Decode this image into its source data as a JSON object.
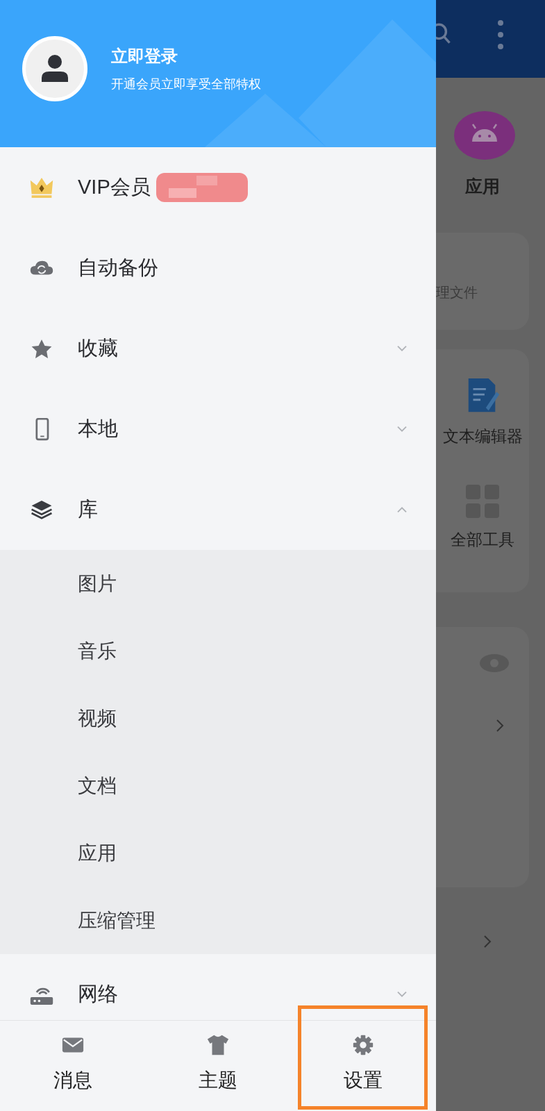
{
  "drawer": {
    "header": {
      "title": "立即登录",
      "subtitle": "开通会员立即享受全部特权"
    },
    "menu": [
      {
        "kind": "link",
        "label": "VIP会员",
        "redacted": true
      },
      {
        "kind": "link",
        "label": "自动备份",
        "redacted": false
      },
      {
        "kind": "group",
        "label": "收藏",
        "expanded": false
      },
      {
        "kind": "group",
        "label": "本地",
        "expanded": false
      },
      {
        "kind": "group",
        "label": "库",
        "expanded": true,
        "children": [
          {
            "label": "图片"
          },
          {
            "label": "音乐"
          },
          {
            "label": "视频"
          },
          {
            "label": "文档"
          },
          {
            "label": "应用"
          },
          {
            "label": "压缩管理"
          }
        ]
      },
      {
        "kind": "group",
        "label": "网络",
        "expanded": false
      }
    ],
    "bottom_nav": [
      {
        "label": "消息"
      },
      {
        "label": "主题"
      },
      {
        "label": "设置",
        "highlighted": true
      }
    ]
  },
  "background": {
    "app_label": "应用",
    "card_subtitle": "理文件",
    "tools": [
      "文本编辑器",
      "全部工具"
    ]
  }
}
